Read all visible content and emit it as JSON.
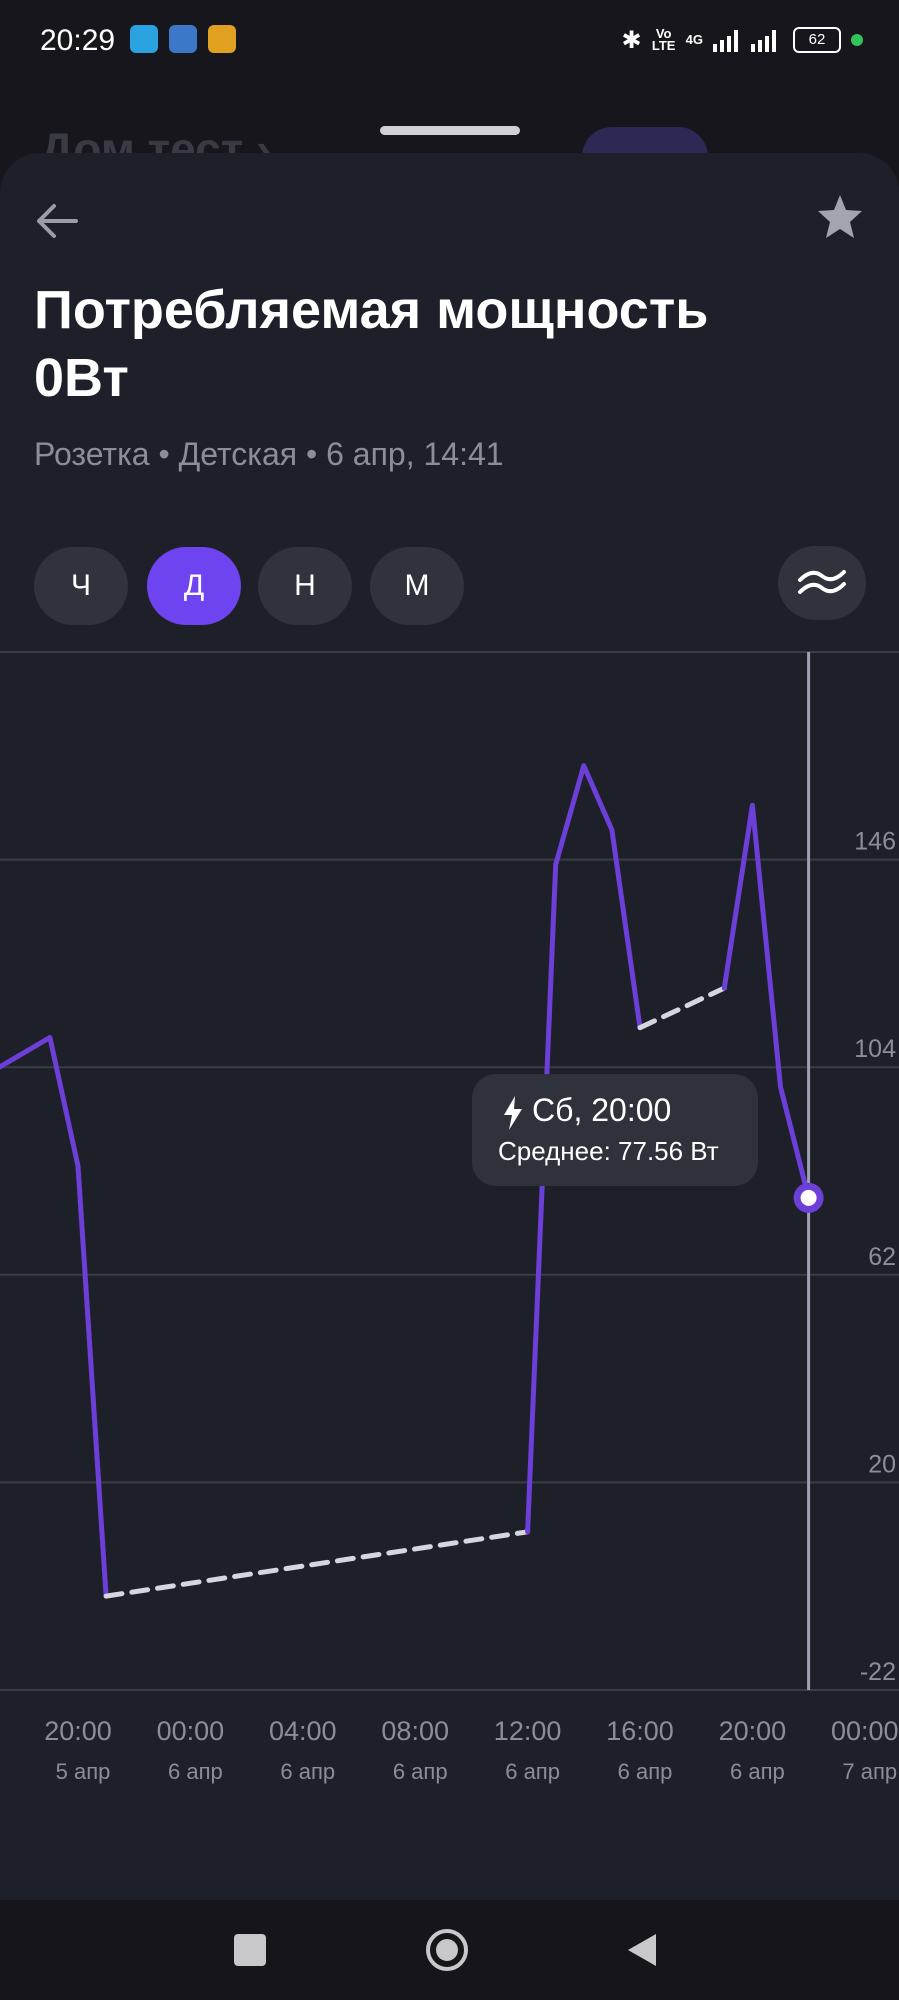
{
  "status_bar": {
    "time": "20:29",
    "network": "4G",
    "volte": "Vo LTE",
    "battery": "62",
    "icons": [
      "telegram-icon",
      "gallery-app-icon",
      "info-app-icon",
      "bluetooth-icon",
      "signal-icon",
      "battery-icon"
    ]
  },
  "background_page": {
    "title": "Дом тест ›"
  },
  "header": {
    "title_line1": "Потребляемая мощность",
    "title_line2": "0Вт",
    "subtitle": "Розетка • Детская • 6 апр, 14:41"
  },
  "periods": [
    {
      "label": "Ч",
      "active": false
    },
    {
      "label": "Д",
      "active": true
    },
    {
      "label": "Н",
      "active": false
    },
    {
      "label": "М",
      "active": false
    }
  ],
  "tooltip": {
    "title": "Сб, 20:00",
    "value": "Среднее: 77.56 Вт"
  },
  "chart_data": {
    "type": "line",
    "y_ticks": [
      "146",
      "104",
      "62",
      "20",
      "-22"
    ],
    "ylim": [
      -22,
      188
    ],
    "x_ticks": [
      {
        "time": "20:00",
        "date": "5 апр"
      },
      {
        "time": "00:00",
        "date": "6 апр"
      },
      {
        "time": "04:00",
        "date": "6 апр"
      },
      {
        "time": "08:00",
        "date": "6 апр"
      },
      {
        "time": "12:00",
        "date": "6 апр"
      },
      {
        "time": "16:00",
        "date": "6 апр"
      },
      {
        "time": "20:00",
        "date": "6 апр"
      },
      {
        "time": "00:00",
        "date": "7 апр"
      }
    ],
    "x_unit": "hours since 20:00 5 апр",
    "series": [
      {
        "segments": [
          {
            "style": "solid",
            "points": [
              [
                -2.8,
                104
              ],
              [
                -1,
                110
              ],
              [
                0,
                84
              ],
              [
                1,
                -3
              ]
            ]
          },
          {
            "style": "dashed",
            "points": [
              [
                1,
                -3
              ],
              [
                16,
                10
              ]
            ]
          },
          {
            "style": "solid",
            "points": [
              [
                16,
                10
              ],
              [
                17,
                145
              ],
              [
                18,
                165
              ],
              [
                19,
                152
              ],
              [
                20,
                112
              ]
            ]
          },
          {
            "style": "dashed",
            "points": [
              [
                20,
                112
              ],
              [
                23,
                120
              ]
            ]
          },
          {
            "style": "solid",
            "points": [
              [
                23,
                120
              ],
              [
                24,
                157
              ],
              [
                25,
                100
              ],
              [
                26,
                77.56
              ]
            ]
          }
        ]
      }
    ],
    "highlight": {
      "x": 26,
      "y": 77.56
    },
    "grid": true,
    "line_color": "#6c3fd8",
    "gap_color": "#d6d6de"
  },
  "colors": {
    "accent": "#6e43f0",
    "sheet": "#1e2029",
    "pill": "#30323c"
  }
}
